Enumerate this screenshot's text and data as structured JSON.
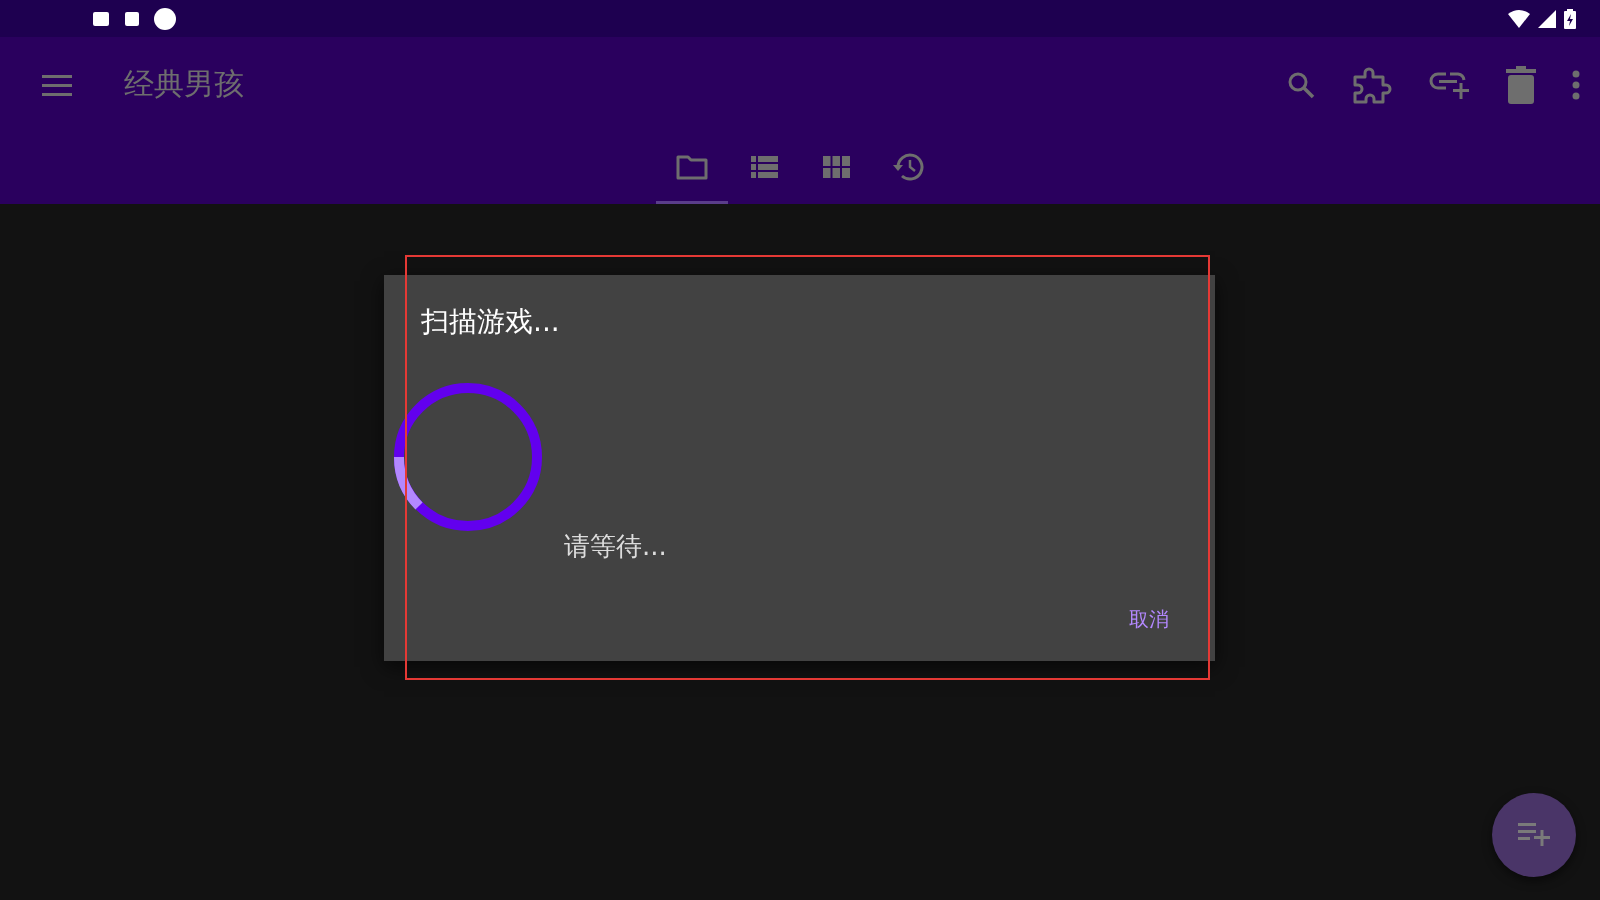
{
  "toolbar": {
    "title": "经典男孩",
    "actions": [
      {
        "kind": "search"
      },
      {
        "kind": "puzzle"
      },
      {
        "kind": "link-add"
      },
      {
        "kind": "trash"
      },
      {
        "kind": "more"
      }
    ]
  },
  "tabs": [
    {
      "kind": "folder",
      "selected": true
    },
    {
      "kind": "list",
      "selected": false
    },
    {
      "kind": "grid",
      "selected": false
    },
    {
      "kind": "history",
      "selected": false
    }
  ],
  "dialog": {
    "title": "扫描游戏...",
    "message": "请等待...",
    "button": "取消"
  }
}
